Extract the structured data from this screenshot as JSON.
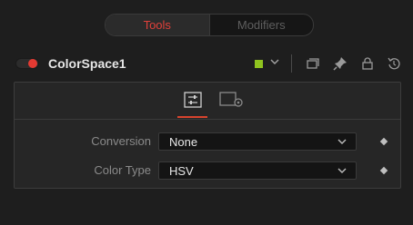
{
  "tabs": [
    {
      "label": "Tools",
      "active": true
    },
    {
      "label": "Modifiers",
      "active": false
    }
  ],
  "node": {
    "name": "ColorSpace1",
    "enabled": true,
    "color_swatch": "#8fc31f",
    "header_icons": [
      "chevron-down-icon",
      "versions-icon",
      "pin-icon",
      "lock-icon",
      "reset-icon"
    ]
  },
  "panel": {
    "tabs": [
      {
        "icon": "sliders-icon",
        "active": true
      },
      {
        "icon": "settings-icon",
        "active": false
      }
    ],
    "rows": [
      {
        "label": "Conversion",
        "value": "None"
      },
      {
        "label": "Color Type",
        "value": "HSV"
      }
    ]
  },
  "colors": {
    "accent_red": "#e0403a",
    "swatch_green": "#8fc31f",
    "background": "#1e1e1e"
  }
}
